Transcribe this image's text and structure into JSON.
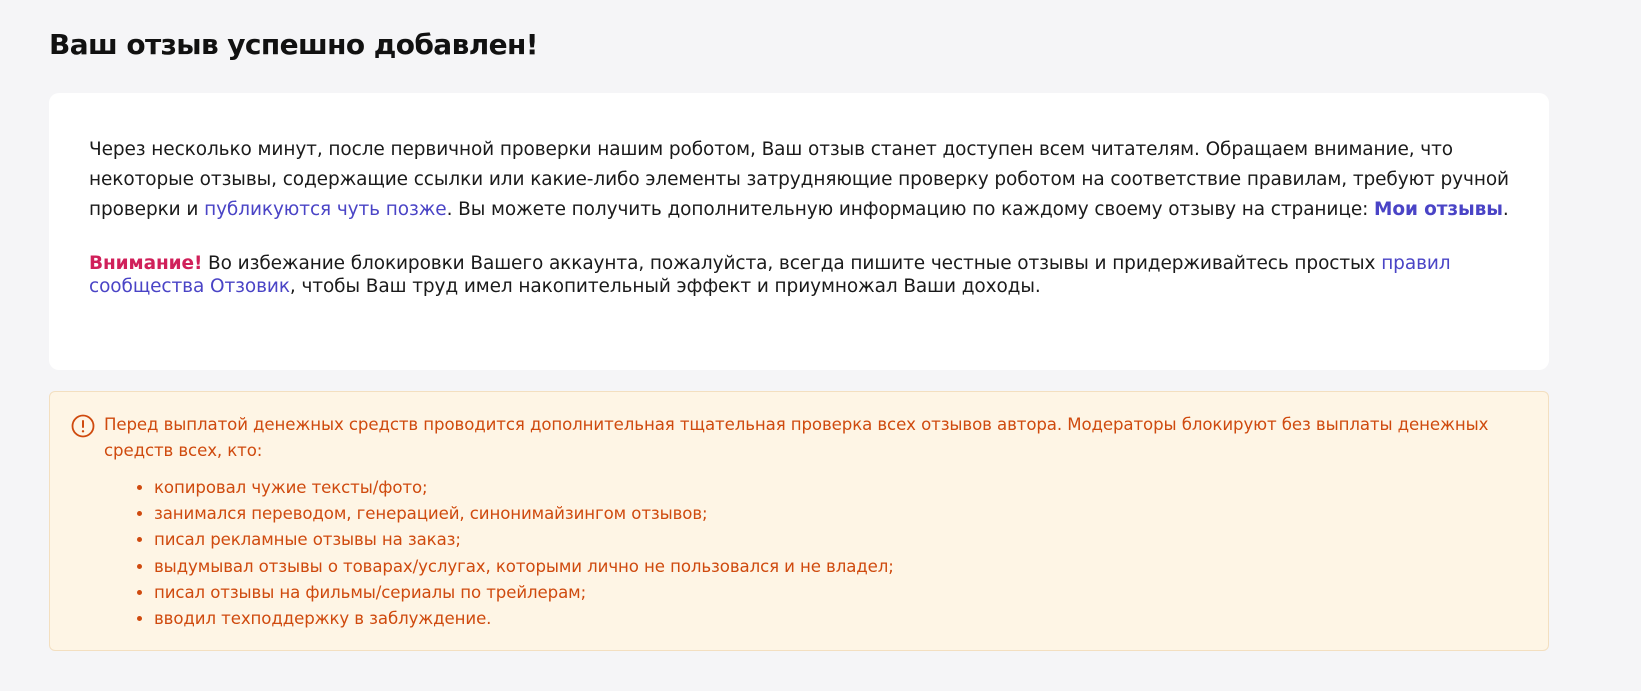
{
  "page": {
    "title": "Ваш отзыв успешно добавлен!"
  },
  "info_card": {
    "paragraph1_text_a": "Через несколько минут, после первичной проверки нашим роботом, Ваш отзыв станет доступен всем читателям. Обращаем внимание, что некоторые отзывы, содержащие ссылки или какие-либо элементы затрудняющие проверку роботом на соответствие правилам, требуют ручной проверки и ",
    "later_link": "публикуются чуть позже",
    "paragraph1_text_b": ". Вы можете получить дополнительную информацию по каждому своему отзыву на странице: ",
    "my_reviews_link": "Мои отзывы",
    "paragraph1_end": ".",
    "warning_label": "Внимание!",
    "paragraph2_text_a": " Во избежание блокировки Вашего аккаунта, пожалуйста, всегда пишите честные отзывы и придерживайтесь простых ",
    "rules_link": "правил сообщества Отзовик",
    "paragraph2_text_b": ", чтобы Ваш труд имел накопительный эффект и приумножал Ваши доходы."
  },
  "notice": {
    "icon": "exclamation-circle-icon",
    "text": "Перед выплатой денежных средств проводится дополнительная тщательная проверка всех отзывов автора. Модераторы блокируют без выплаты денежных средств всех, кто:",
    "items": [
      "копировал чужие тексты/фото;",
      "занимался переводом, генерацией, синонимайзингом отзывов;",
      "писал рекламные отзывы на заказ;",
      "выдумывал отзывы о товарах/услугах, которыми лично не пользовался и не владел;",
      "писал отзывы на фильмы/сериалы по трейлерам;",
      "вводил техподдержку в заблуждение."
    ]
  },
  "colors": {
    "page_background": "#f5f5f7",
    "card_background": "#ffffff",
    "link": "#4a44c6",
    "warning": "#d0205a",
    "notice_background": "#fef5e5",
    "notice_border": "#f3dfc0",
    "notice_text": "#cf4a0e"
  }
}
